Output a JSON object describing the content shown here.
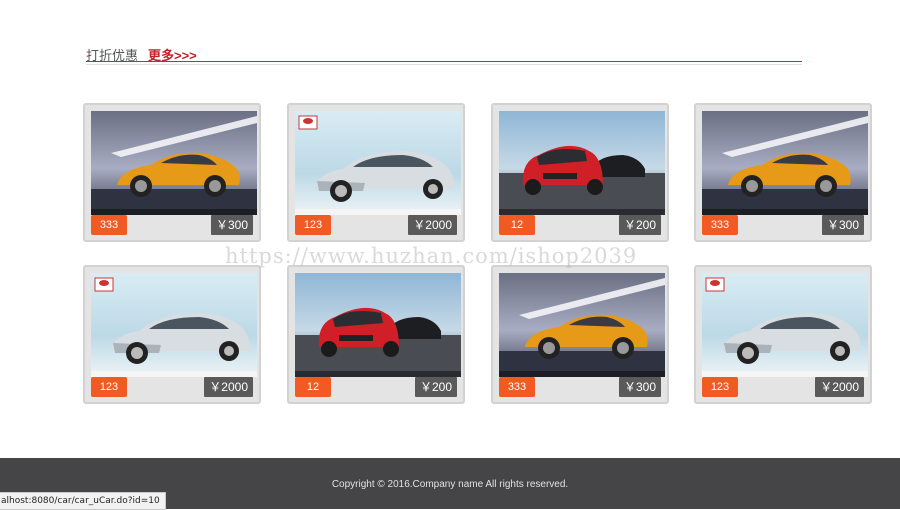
{
  "section": {
    "title": "打折优惠",
    "more_label": "更多>>>"
  },
  "colors": {
    "accent": "#c0222a",
    "badge": "#f15a22",
    "price_bg": "#5a5a5a",
    "footer_bg": "#454446"
  },
  "products": [
    {
      "badge": "333",
      "price": "￥300",
      "car": "yellow-coupe"
    },
    {
      "badge": "123",
      "price": "￥2000",
      "car": "silver-sedan"
    },
    {
      "badge": "12",
      "price": "￥200",
      "car": "red-bmw"
    },
    {
      "badge": "333",
      "price": "￥300",
      "car": "yellow-coupe"
    },
    {
      "badge": "123",
      "price": "￥2000",
      "car": "silver-sedan"
    },
    {
      "badge": "12",
      "price": "￥200",
      "car": "red-bmw"
    },
    {
      "badge": "333",
      "price": "￥300",
      "car": "yellow-coupe"
    },
    {
      "badge": "123",
      "price": "￥2000",
      "car": "silver-sedan"
    }
  ],
  "watermark": "https://www.huzhan.com/ishop2039",
  "footer": {
    "copyright": "Copyright © 2016.Company name All rights reserved."
  },
  "status_bar": {
    "url": "alhost:8080/car/car_uCar.do?id=10"
  }
}
